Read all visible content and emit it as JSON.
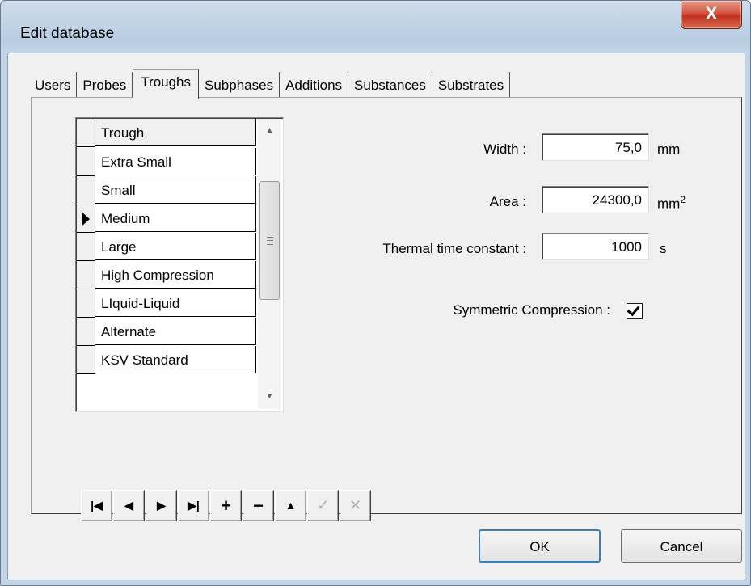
{
  "window": {
    "title": "Edit database",
    "close_symbol": "X"
  },
  "tabs": [
    {
      "label": "Users"
    },
    {
      "label": "Probes"
    },
    {
      "label": "Troughs"
    },
    {
      "label": "Subphases"
    },
    {
      "label": "Additions"
    },
    {
      "label": "Substances"
    },
    {
      "label": "Substrates"
    }
  ],
  "active_tab": "Troughs",
  "grid": {
    "header": "Trough",
    "rows": [
      {
        "label": "Extra Small"
      },
      {
        "label": "Small"
      },
      {
        "label": "Medium"
      },
      {
        "label": "Large"
      },
      {
        "label": "High Compression"
      },
      {
        "label": "LIquid-Liquid"
      },
      {
        "label": "Alternate"
      },
      {
        "label": "KSV Standard"
      }
    ],
    "selected_row": "Medium"
  },
  "fields": {
    "width": {
      "label": "Width :",
      "value": "75,0",
      "unit": "mm"
    },
    "area": {
      "label": "Area :",
      "value": "24300,0",
      "unit": "mm",
      "unit_sup": "2"
    },
    "thermal": {
      "label": "Thermal time constant :",
      "value": "1000",
      "unit": "s"
    },
    "symmetric": {
      "label": "Symmetric Compression :",
      "checked": true
    }
  },
  "navigator": [
    {
      "symbol": "|◀",
      "name": "first-record-button",
      "enabled": true
    },
    {
      "symbol": "◀",
      "name": "prior-record-button",
      "enabled": true
    },
    {
      "symbol": "▶",
      "name": "next-record-button",
      "enabled": true
    },
    {
      "symbol": "▶|",
      "name": "last-record-button",
      "enabled": true
    },
    {
      "symbol": "+",
      "name": "insert-record-button",
      "enabled": true
    },
    {
      "symbol": "−",
      "name": "delete-record-button",
      "enabled": true
    },
    {
      "symbol": "▲",
      "name": "edit-record-button",
      "enabled": true
    },
    {
      "symbol": "✓",
      "name": "post-record-button",
      "enabled": false
    },
    {
      "symbol": "✕",
      "name": "cancel-edit-button",
      "enabled": false
    }
  ],
  "buttons": {
    "ok": "OK",
    "cancel": "Cancel"
  }
}
